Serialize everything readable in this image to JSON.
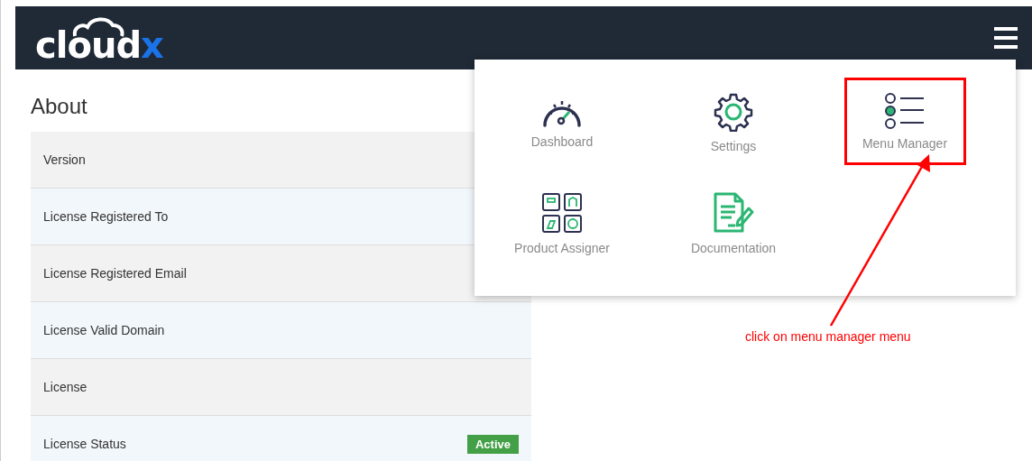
{
  "header": {
    "logo": {
      "main": "cloud",
      "accent": "x"
    }
  },
  "page": {
    "title": "About"
  },
  "about_rows": [
    {
      "label": "Version"
    },
    {
      "label": "License Registered To"
    },
    {
      "label": "License Registered Email"
    },
    {
      "label": "License Valid Domain"
    },
    {
      "label": "License"
    },
    {
      "label": "License Status",
      "badge": "Active"
    }
  ],
  "menu_panel": {
    "items": [
      {
        "kind": "dashboard",
        "label": "Dashboard",
        "highlighted": false
      },
      {
        "kind": "settings",
        "label": "Settings",
        "highlighted": false
      },
      {
        "kind": "menu-manager",
        "label": "Menu Manager",
        "highlighted": true
      },
      {
        "kind": "product-assigner",
        "label": "Product Assigner",
        "highlighted": false
      },
      {
        "kind": "documentation",
        "label": "Documentation",
        "highlighted": false
      }
    ]
  },
  "annotation": {
    "text": "click on menu manager menu"
  }
}
